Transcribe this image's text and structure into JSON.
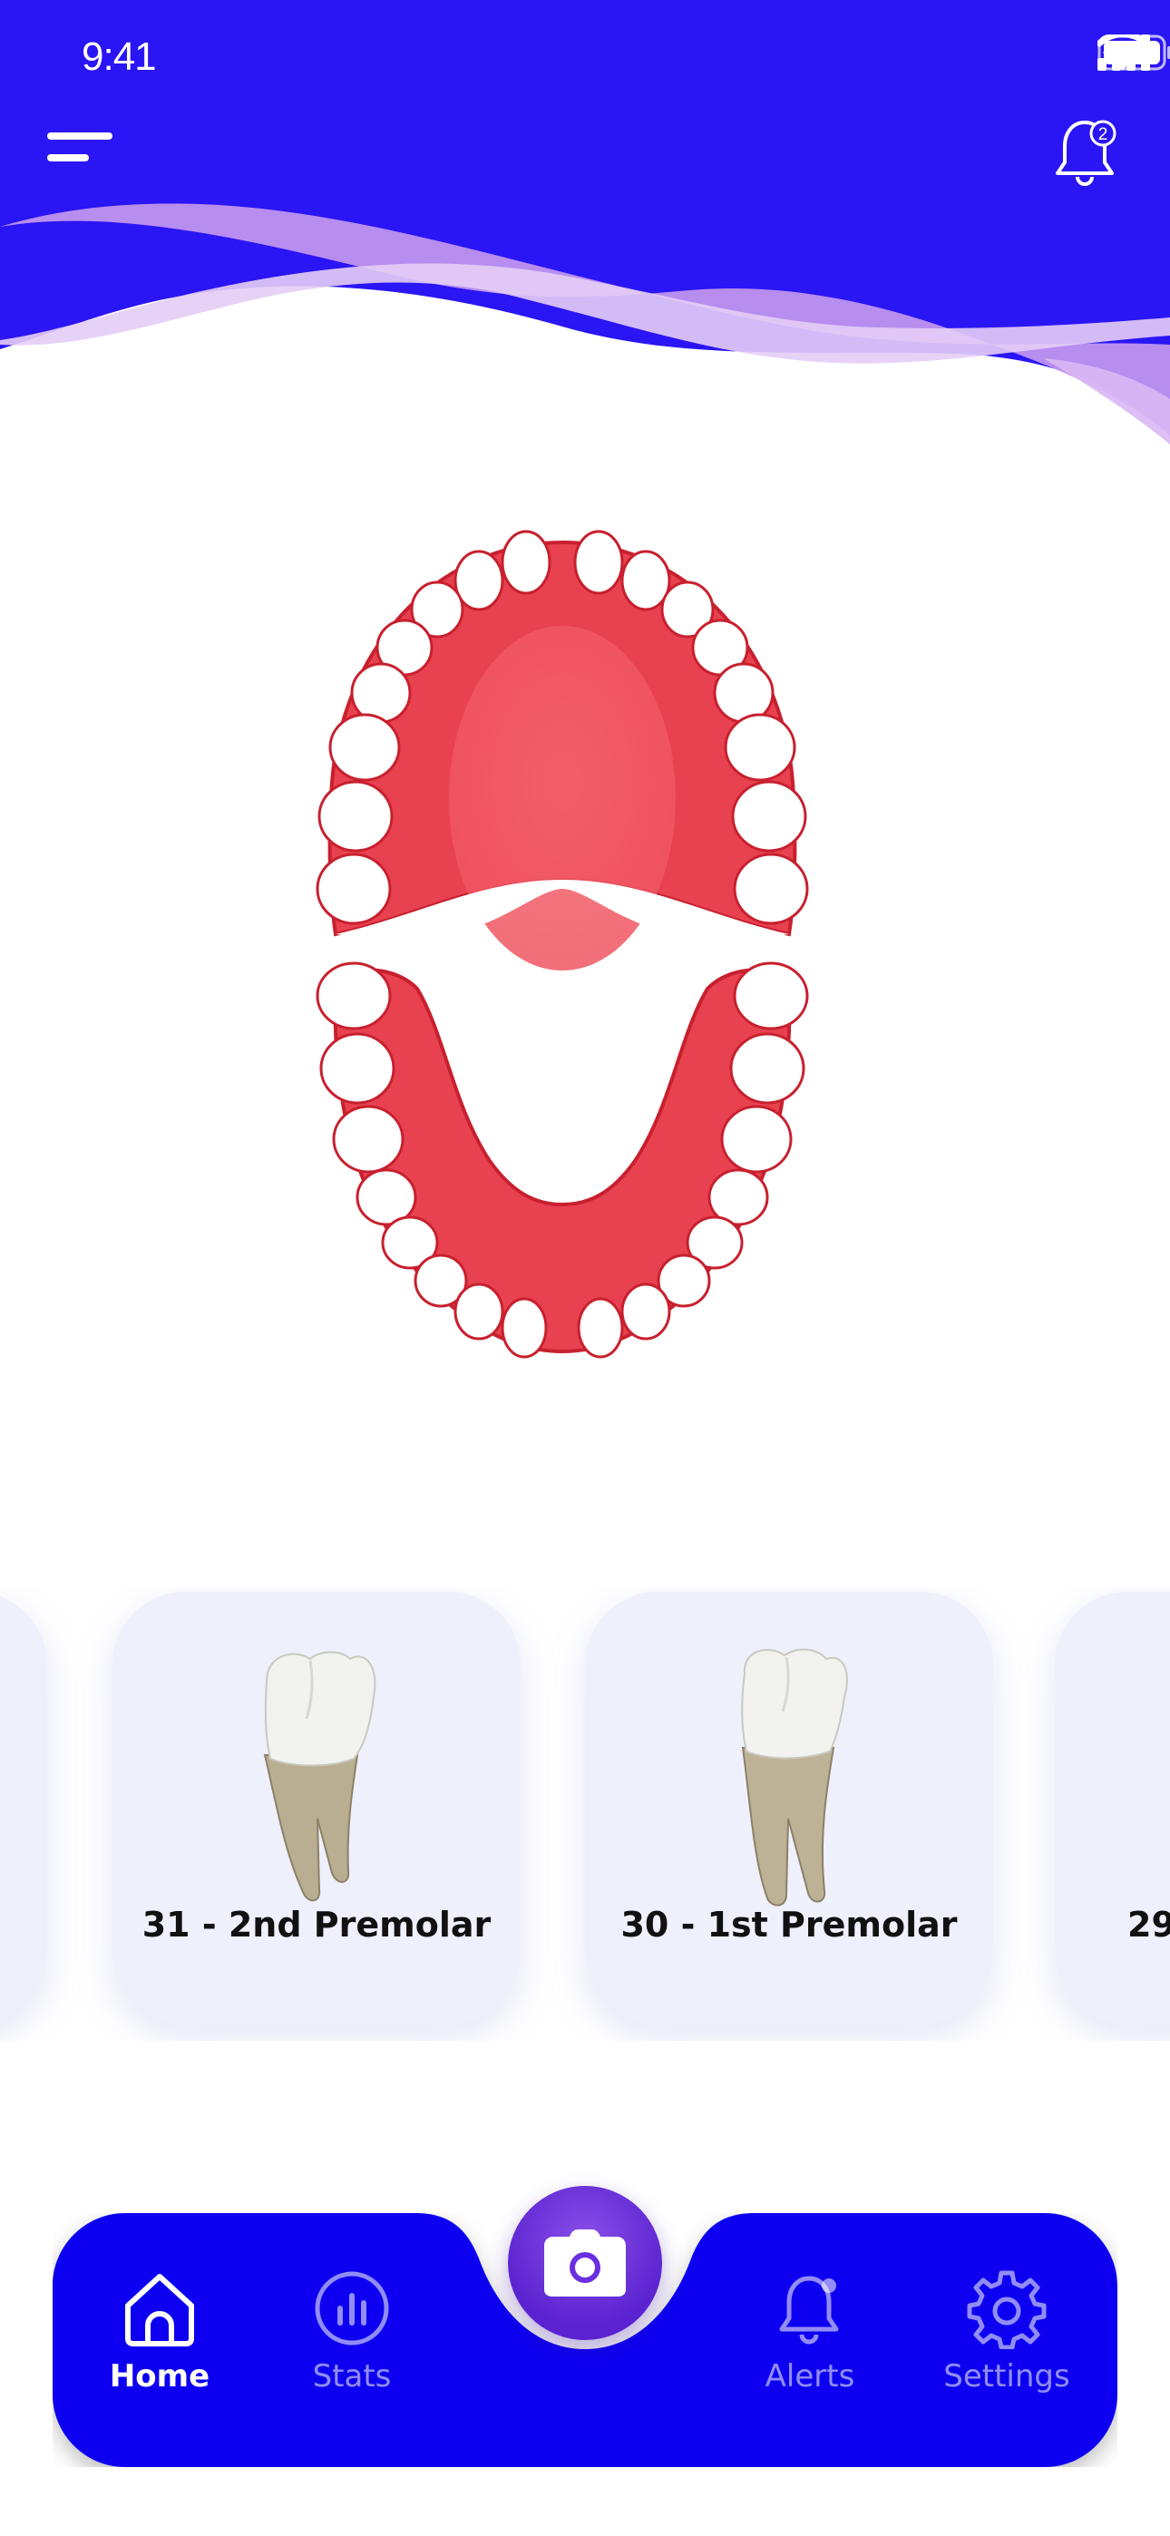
{
  "status_bar": {
    "time": "9:41"
  },
  "header": {
    "notification_count": "2"
  },
  "teeth_cards": [
    {
      "label": ""
    },
    {
      "label": "31 - 2nd Premolar"
    },
    {
      "label": "30 - 1st Premolar"
    },
    {
      "label": "29"
    }
  ],
  "nav": {
    "items": [
      {
        "label": "Home",
        "icon": "home-icon",
        "active": true
      },
      {
        "label": "Stats",
        "icon": "stats-icon",
        "active": false
      },
      {
        "label": "Alerts",
        "icon": "bell-icon",
        "active": false
      },
      {
        "label": "Settings",
        "icon": "gear-icon",
        "active": false
      }
    ],
    "center_icon": "camera-icon"
  },
  "colors": {
    "brand_blue": "#2a15f5",
    "nav_blue": "#0a00f0",
    "wave_purple": "#c79af0",
    "gum_red": "#e8414f",
    "camera_purple": "#6a2fe0",
    "card_bg": "#eef1fb"
  }
}
